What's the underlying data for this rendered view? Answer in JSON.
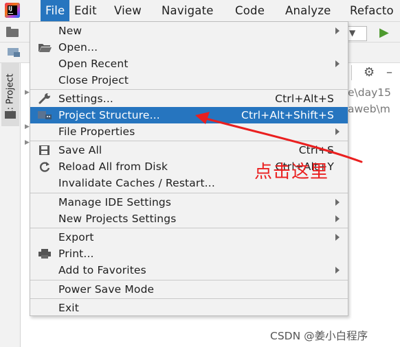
{
  "menubar": {
    "menus": [
      "File",
      "Edit",
      "View",
      "Navigate",
      "Code",
      "Analyze",
      "Refacto"
    ]
  },
  "sidebar": {
    "project_tab_label": "1: Project"
  },
  "background": {
    "path_line_1": "e\\day15",
    "path_line_2": "aweb\\m"
  },
  "file_menu": {
    "items": [
      {
        "label": "New",
        "shortcut": "",
        "submenu": true
      },
      {
        "label": "Open...",
        "shortcut": "",
        "submenu": false
      },
      {
        "label": "Open Recent",
        "shortcut": "",
        "submenu": true
      },
      {
        "label": "Close Project",
        "shortcut": "",
        "submenu": false
      },
      {
        "label": "Settings...",
        "shortcut": "Ctrl+Alt+S",
        "submenu": false
      },
      {
        "label": "Project Structure...",
        "shortcut": "Ctrl+Alt+Shift+S",
        "submenu": false,
        "selected": true
      },
      {
        "label": "File Properties",
        "shortcut": "",
        "submenu": true
      },
      {
        "label": "Save All",
        "shortcut": "Ctrl+S",
        "submenu": false
      },
      {
        "label": "Reload All from Disk",
        "shortcut": "Ctrl+Alt+Y",
        "submenu": false
      },
      {
        "label": "Invalidate Caches / Restart...",
        "shortcut": "",
        "submenu": false
      },
      {
        "label": "Manage IDE Settings",
        "shortcut": "",
        "submenu": true
      },
      {
        "label": "New Projects Settings",
        "shortcut": "",
        "submenu": true
      },
      {
        "label": "Export",
        "shortcut": "",
        "submenu": true
      },
      {
        "label": "Print...",
        "shortcut": "",
        "submenu": false
      },
      {
        "label": "Add to Favorites",
        "shortcut": "",
        "submenu": true
      },
      {
        "label": "Power Save Mode",
        "shortcut": "",
        "submenu": false
      },
      {
        "label": "Exit",
        "shortcut": "",
        "submenu": false
      }
    ]
  },
  "icons": {
    "open": "folder-open-icon",
    "settings": "wrench-icon",
    "project_structure": "project-structure-icon",
    "save_all": "save-icon",
    "reload": "reload-icon",
    "print": "printer-icon",
    "run": "run-icon",
    "gear": "gear-icon"
  },
  "annotation": {
    "text": "点击这里"
  },
  "watermark": {
    "text": "CSDN @姜小白程序"
  },
  "colors": {
    "selection": "#2675bf",
    "menu_bg": "#f2f2f2",
    "annotation_red": "#ea1f1f",
    "run_green": "#4e9a2f"
  }
}
